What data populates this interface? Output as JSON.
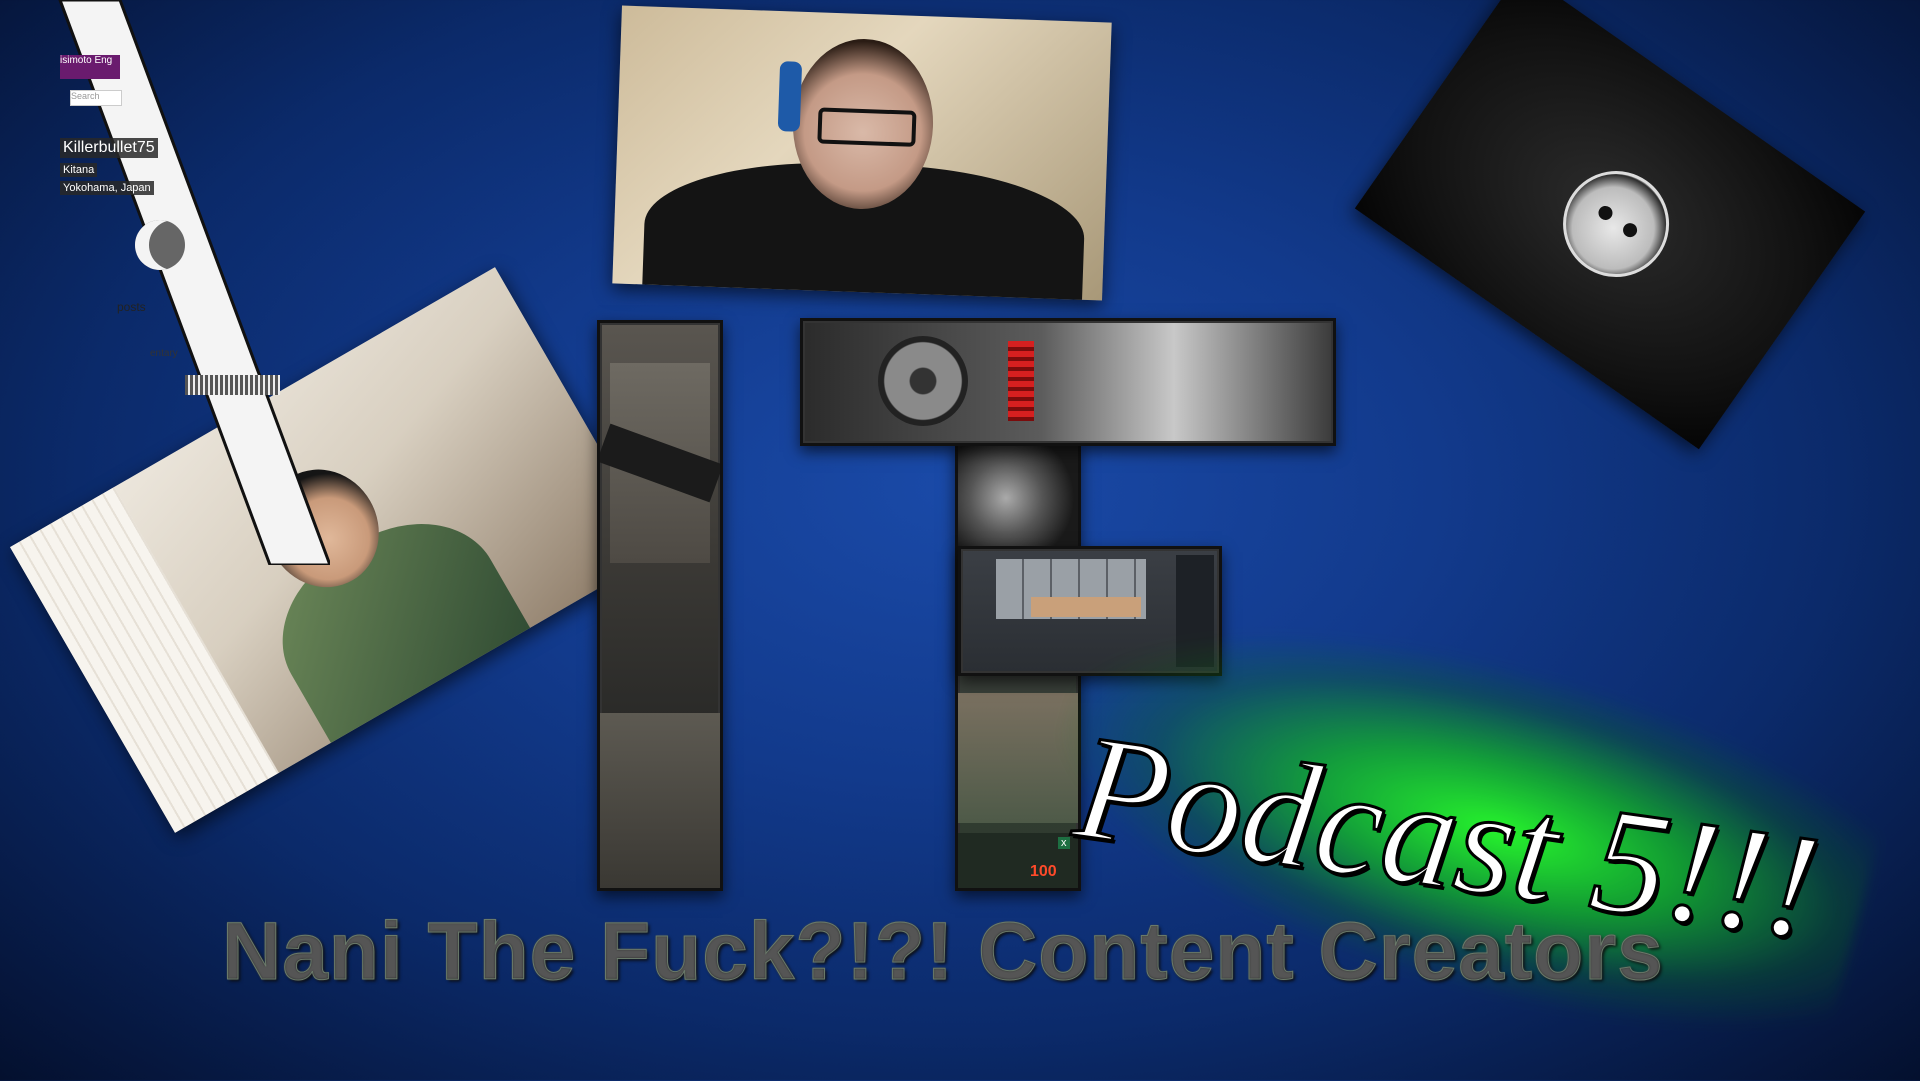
{
  "title_text": "Nani The Fuck?!?! Content Creators",
  "podcast_text": "Podcast 5!!!",
  "profile": {
    "username": "Killerbullet75",
    "character": "Kitana",
    "location": "Yokohama, Japan",
    "tab_fragment": "isimoto Eng",
    "search_placeholder": "Search",
    "posts_fragment": "posts",
    "entary_fragment": "entary"
  },
  "hud": {
    "health_value": "100",
    "spreadsheet_icon": "x"
  },
  "colors": {
    "background": "#123a8c",
    "glow": "#28ff28",
    "profile_purple": "#6a1b6e"
  }
}
